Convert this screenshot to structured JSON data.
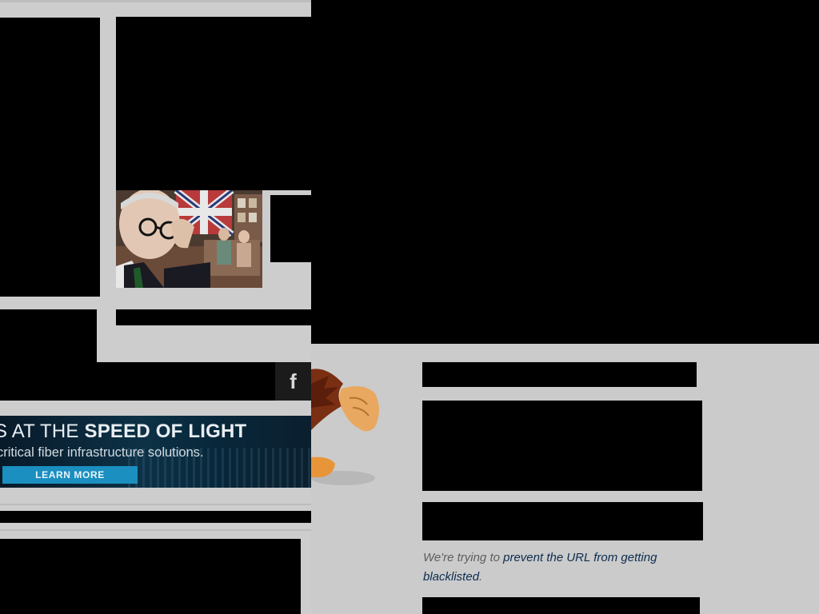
{
  "left_page": {
    "social": {
      "facebook_glyph": "f"
    },
    "ad_banner": {
      "headline_prefix": "S AT THE ",
      "headline_bold": "SPEED OF LIGHT",
      "subline": "critical fiber infrastructure solutions.",
      "button_label": "LEARN MORE"
    }
  },
  "error_page": {
    "message_prefix": "We're trying to ",
    "message_link": "prevent the URL from getting blacklisted",
    "message_suffix": "."
  },
  "colors": {
    "background": "#cbcbcb",
    "redaction": "#000000",
    "banner_button": "#1a8fc0",
    "link": "#0b2c4f"
  }
}
